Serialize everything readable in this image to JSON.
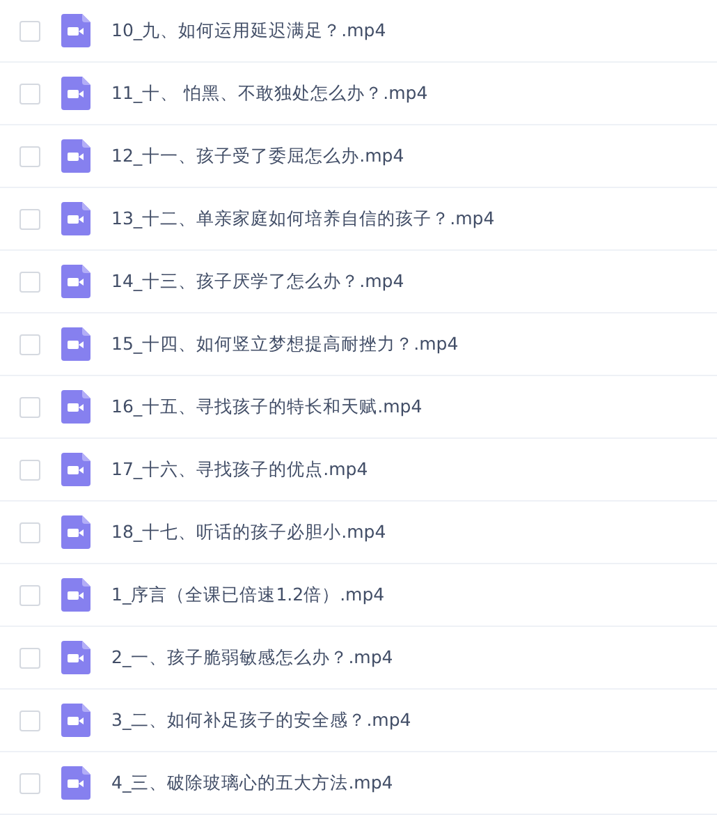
{
  "files": [
    {
      "name": "10_九、如何运用延迟满足？.mp4",
      "checked": false
    },
    {
      "name": "11_十、 怕黑、不敢独处怎么办？.mp4",
      "checked": false
    },
    {
      "name": "12_十一、孩子受了委屈怎么办.mp4",
      "checked": false
    },
    {
      "name": "13_十二、单亲家庭如何培养自信的孩子？.mp4",
      "checked": false
    },
    {
      "name": "14_十三、孩子厌学了怎么办？.mp4",
      "checked": false
    },
    {
      "name": "15_十四、如何竖立梦想提高耐挫力？.mp4",
      "checked": false
    },
    {
      "name": "16_十五、寻找孩子的特长和天赋.mp4",
      "checked": false
    },
    {
      "name": "17_十六、寻找孩子的优点.mp4",
      "checked": false
    },
    {
      "name": "18_十七、听话的孩子必胆小.mp4",
      "checked": false
    },
    {
      "name": "1_序言（全课已倍速1.2倍）.mp4",
      "checked": false
    },
    {
      "name": "2_一、孩子脆弱敏感怎么办？.mp4",
      "checked": false
    },
    {
      "name": "3_二、如何补足孩子的安全感？.mp4",
      "checked": false
    },
    {
      "name": "4_三、破除玻璃心的五大方法.mp4",
      "checked": false
    }
  ]
}
